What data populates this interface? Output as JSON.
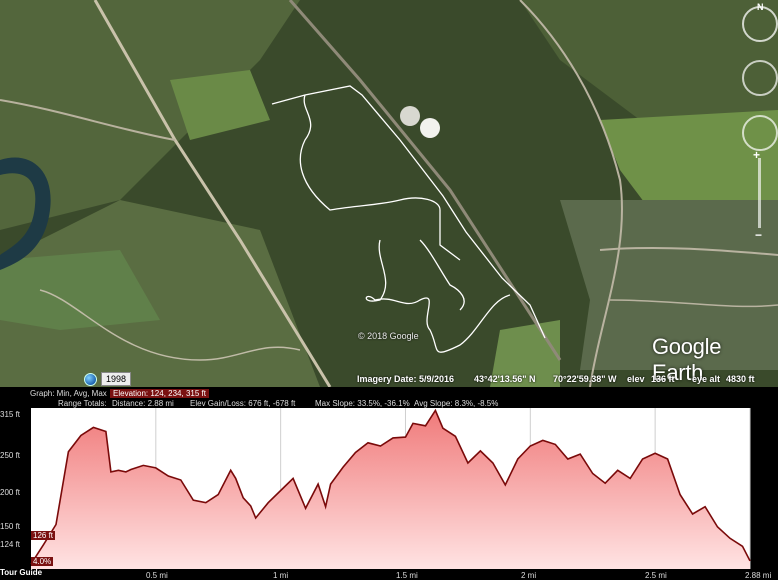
{
  "map": {
    "copyright": "© 2018 Google",
    "logo": "Google Earth",
    "history_year": "1998",
    "compass_north": "N",
    "status": {
      "imagery_date_label": "Imagery Date: 5/9/2016",
      "lat": "43°42'13.56\" N",
      "lon": "70°22'59.38\" W",
      "elev_label": "elev",
      "elev_value": "136 ft",
      "eye_alt_label": "eye alt",
      "eye_alt_value": "4830 ft"
    },
    "colors": {
      "trail": "#ffffff",
      "forest": "#3b4a2c",
      "field": "#6e8f4a"
    }
  },
  "profile": {
    "graph_label": "Graph: Min, Avg, Max",
    "elevation_stats": "Elevation: 124, 234, 315 ft",
    "range_totals": "Range Totals:",
    "distance": "Distance: 2.88 mi",
    "elev_gain_loss": "Elev Gain/Loss: 676 ft, -678 ft",
    "max_slope": "Max Slope: 33.5%, -36.1%",
    "avg_slope": "Avg Slope: 8.3%, -8.5%",
    "current_elev": "126 ft",
    "current_slope": "4.0%",
    "tour_guide": "Tour Guide",
    "y_ticks": [
      "315 ft",
      "250 ft",
      "200 ft",
      "150 ft",
      "124 ft"
    ],
    "x_ticks": [
      "0.5 mi",
      "1 mi",
      "1.5 mi",
      "2 mi",
      "2.5 mi",
      "2.88 mi"
    ],
    "colors": {
      "line": "#7a0a0a",
      "fill_top": "#f07a7a",
      "fill_bottom": "#ffe3e3"
    }
  },
  "chart_data": {
    "type": "area",
    "xlabel": "",
    "ylabel": "",
    "xlim": [
      0,
      2.88
    ],
    "ylim": [
      124,
      315
    ],
    "x_ticks": [
      0.5,
      1,
      1.5,
      2,
      2.5,
      2.88
    ],
    "y_ticks": [
      124,
      150,
      200,
      250,
      315
    ],
    "x": [
      0,
      0.05,
      0.1,
      0.15,
      0.2,
      0.25,
      0.3,
      0.32,
      0.35,
      0.38,
      0.4,
      0.45,
      0.5,
      0.55,
      0.6,
      0.65,
      0.7,
      0.75,
      0.8,
      0.82,
      0.85,
      0.88,
      0.9,
      0.95,
      1.0,
      1.05,
      1.1,
      1.15,
      1.18,
      1.2,
      1.25,
      1.3,
      1.35,
      1.4,
      1.45,
      1.5,
      1.53,
      1.58,
      1.62,
      1.65,
      1.7,
      1.75,
      1.8,
      1.85,
      1.9,
      1.95,
      2.0,
      2.05,
      2.1,
      2.15,
      2.2,
      2.25,
      2.3,
      2.35,
      2.4,
      2.45,
      2.5,
      2.55,
      2.6,
      2.65,
      2.7,
      2.75,
      2.8,
      2.85,
      2.88
    ],
    "y": [
      126,
      150,
      175,
      265,
      285,
      295,
      290,
      240,
      242,
      240,
      243,
      248,
      245,
      235,
      230,
      205,
      202,
      212,
      242,
      232,
      208,
      198,
      183,
      202,
      217,
      232,
      195,
      225,
      197,
      225,
      246,
      264,
      276,
      272,
      282,
      283,
      300,
      297,
      316,
      294,
      284,
      251,
      266,
      251,
      224,
      256,
      272,
      279,
      274,
      256,
      262,
      238,
      226,
      242,
      232,
      256,
      263,
      256,
      212,
      188,
      197,
      172,
      158,
      148,
      130
    ]
  }
}
